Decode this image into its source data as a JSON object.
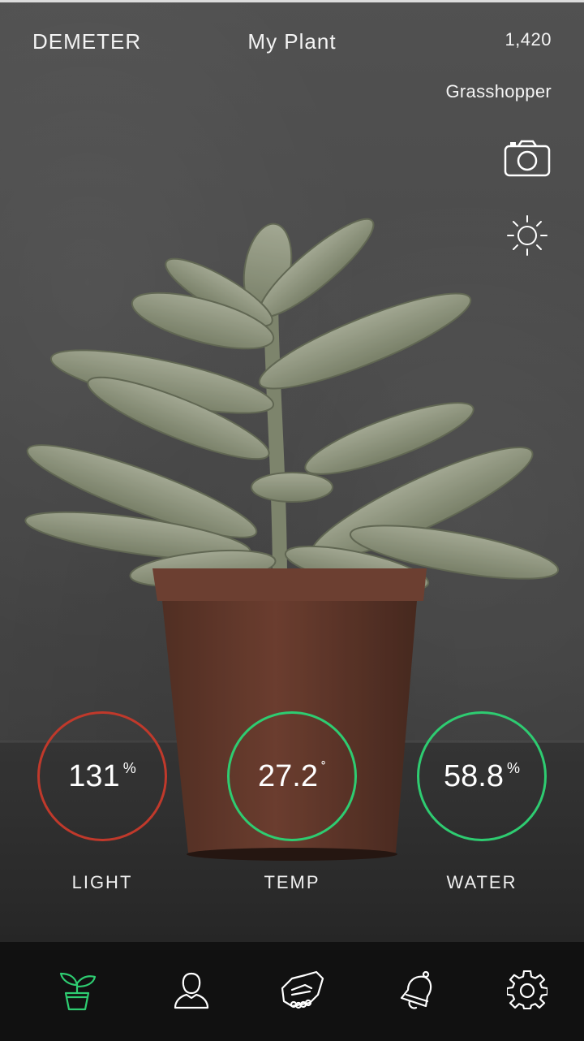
{
  "header": {
    "app_name": "DEMETER",
    "title": "My Plant",
    "points": "1,420",
    "rank": "Grasshopper"
  },
  "actions": {
    "camera_icon": "camera-icon",
    "light_icon": "sun-icon"
  },
  "metrics": [
    {
      "label": "LIGHT",
      "value": "131",
      "unit": "%",
      "status_color": "#c0392b"
    },
    {
      "label": "TEMP",
      "value": "27.2",
      "unit": "˚",
      "status_color": "#2ecc71"
    },
    {
      "label": "WATER",
      "value": "58.8",
      "unit": "%",
      "status_color": "#2ecc71"
    }
  ],
  "nav": {
    "items": [
      {
        "icon": "plant-icon",
        "active": true
      },
      {
        "icon": "profile-icon",
        "active": false
      },
      {
        "icon": "handshake-icon",
        "active": false
      },
      {
        "icon": "bell-icon",
        "active": false
      },
      {
        "icon": "gear-icon",
        "active": false
      }
    ],
    "active_color": "#2ecc71"
  }
}
